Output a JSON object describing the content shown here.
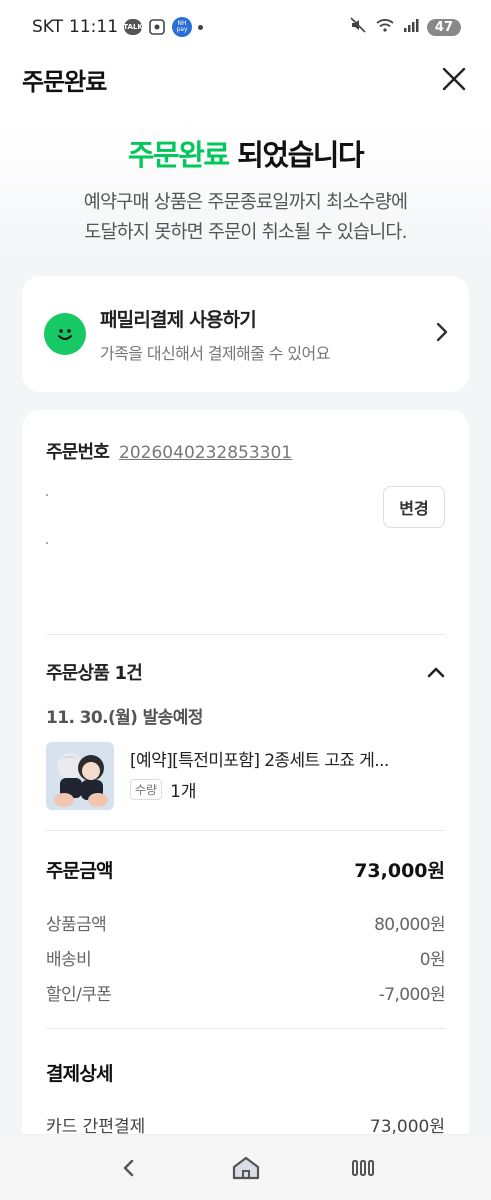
{
  "status": {
    "carrier": "SKT",
    "time": "11:11",
    "icons": [
      "talk-icon",
      "screenshot-icon",
      "nh-pay-icon"
    ],
    "talk_label": "TALK",
    "nh_label": "NH pay",
    "battery": "47"
  },
  "header": {
    "title": "주문완료"
  },
  "hero": {
    "title_highlight": "주문완료",
    "title_rest": " 되었습니다",
    "desc_line1": "예약구매 상품은 주문종료일까지 최소수량에",
    "desc_line2": "도달하지 못하면 주문이 취소될 수 있습니다."
  },
  "family": {
    "title": "패밀리결제 사용하기",
    "subtitle": "가족을 대신해서 결제해줄 수 있어요"
  },
  "order": {
    "number_label": "주문번호",
    "number": "2026040232853301",
    "change_label": "변경"
  },
  "items": {
    "title": "주문상품 1건",
    "ship_date": "11. 30.(월) 발송예정",
    "product_name": "[예약][특전미포함] 2종세트 고죠 게...",
    "qty_label": "수량",
    "qty_value": "1개"
  },
  "summary": {
    "total_label": "주문금액",
    "total_value": "73,000원",
    "rows": [
      {
        "label": "상품금액",
        "value": "80,000원"
      },
      {
        "label": "배송비",
        "value": "0원"
      },
      {
        "label": "할인/쿠폰",
        "value": "-7,000원"
      }
    ]
  },
  "payment": {
    "title": "결제상세",
    "method_label": "카드 간편결제",
    "method_value": "73,000원"
  },
  "colors": {
    "accent_green": "#03c75a",
    "family_icon": "#17c964"
  }
}
